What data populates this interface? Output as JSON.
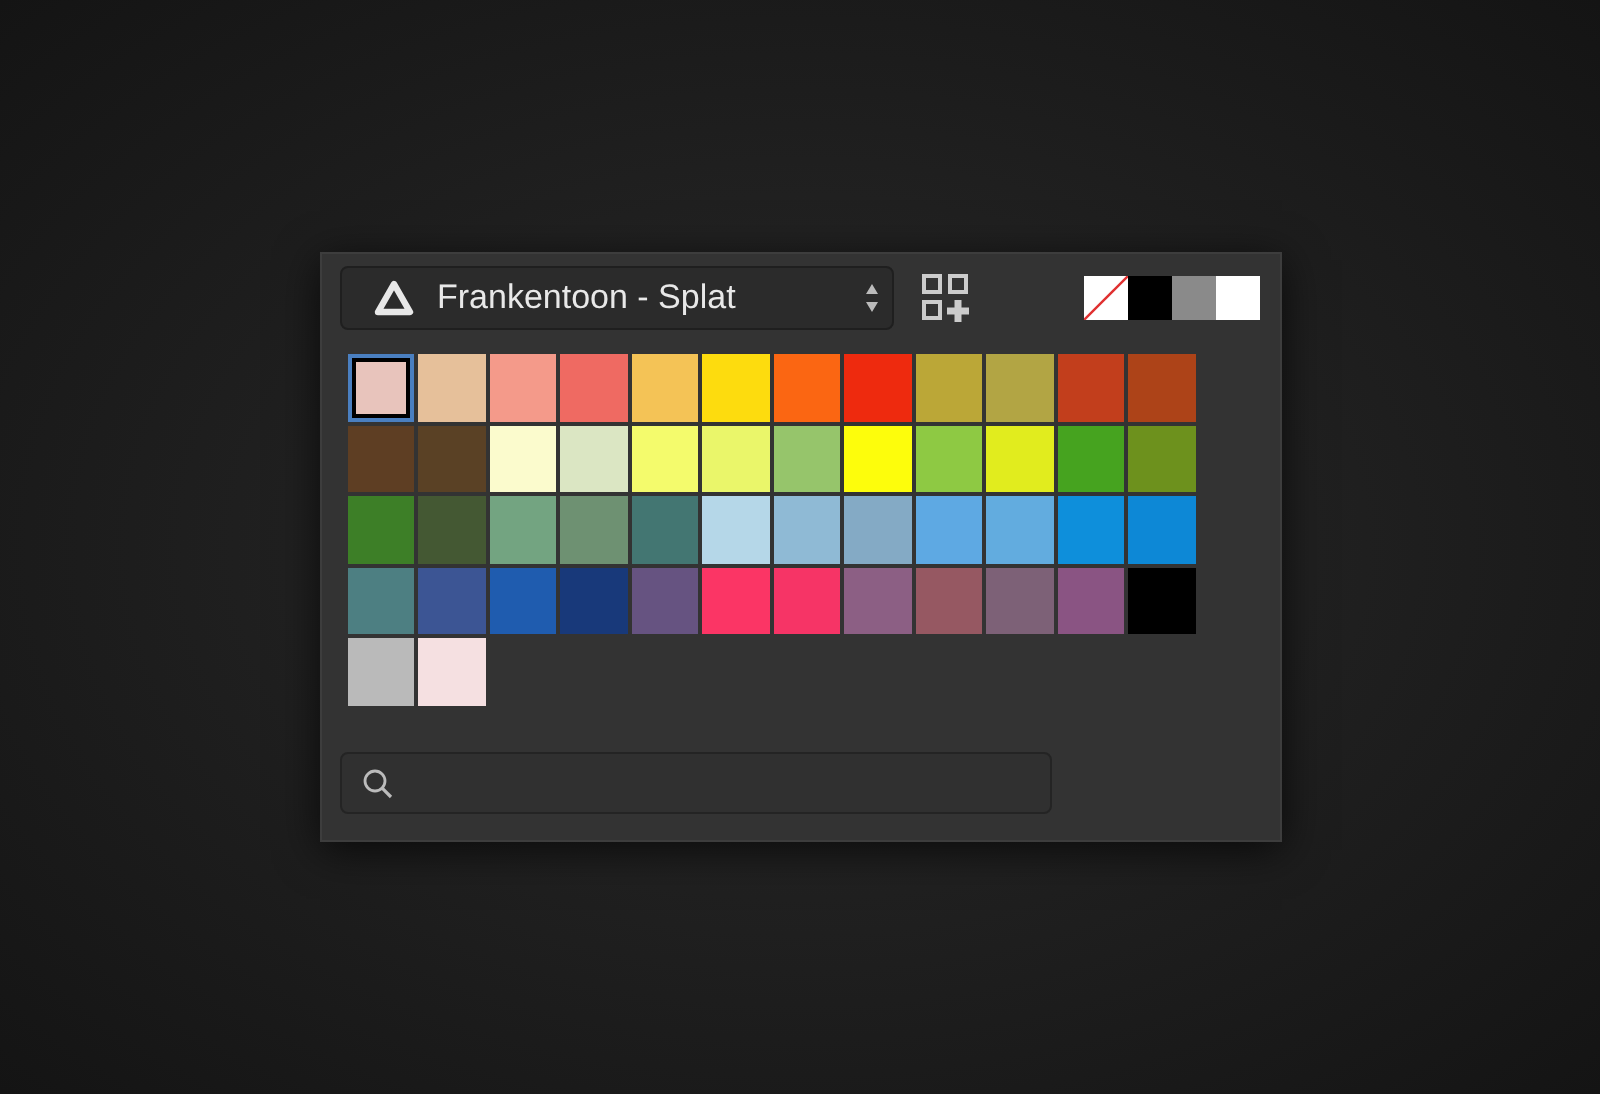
{
  "palette_selector": {
    "name": "Frankentoon - Splat"
  },
  "quick_swatches": [
    {
      "kind": "none",
      "color": "#ffffff"
    },
    {
      "kind": "solid",
      "color": "#000000"
    },
    {
      "kind": "solid",
      "color": "#8a8a8a"
    },
    {
      "kind": "solid",
      "color": "#ffffff"
    }
  ],
  "swatches": [
    {
      "color": "#e8c4bc",
      "selected": true
    },
    {
      "color": "#e6c09a",
      "selected": false
    },
    {
      "color": "#f49a8a",
      "selected": false
    },
    {
      "color": "#ef6a62",
      "selected": false
    },
    {
      "color": "#f4c356",
      "selected": false
    },
    {
      "color": "#fddc0e",
      "selected": false
    },
    {
      "color": "#fb6612",
      "selected": false
    },
    {
      "color": "#ee2a0e",
      "selected": false
    },
    {
      "color": "#bba737",
      "selected": false
    },
    {
      "color": "#b2a544",
      "selected": false
    },
    {
      "color": "#c23e1c",
      "selected": false
    },
    {
      "color": "#ad4318",
      "selected": false
    },
    {
      "color": "#5e3e23",
      "selected": false
    },
    {
      "color": "#5a4125",
      "selected": false
    },
    {
      "color": "#fbfbcd",
      "selected": false
    },
    {
      "color": "#dbe6c3",
      "selected": false
    },
    {
      "color": "#f4fb6c",
      "selected": false
    },
    {
      "color": "#eaf66a",
      "selected": false
    },
    {
      "color": "#96c56b",
      "selected": false
    },
    {
      "color": "#fdfd0c",
      "selected": false
    },
    {
      "color": "#8ec943",
      "selected": false
    },
    {
      "color": "#e1ec1e",
      "selected": false
    },
    {
      "color": "#46a31f",
      "selected": false
    },
    {
      "color": "#6d911d",
      "selected": false
    },
    {
      "color": "#3d7f27",
      "selected": false
    },
    {
      "color": "#445833",
      "selected": false
    },
    {
      "color": "#73a481",
      "selected": false
    },
    {
      "color": "#6e9172",
      "selected": false
    },
    {
      "color": "#437672",
      "selected": false
    },
    {
      "color": "#b5d7e8",
      "selected": false
    },
    {
      "color": "#8fbad5",
      "selected": false
    },
    {
      "color": "#84aac5",
      "selected": false
    },
    {
      "color": "#5ea9e3",
      "selected": false
    },
    {
      "color": "#62acdf",
      "selected": false
    },
    {
      "color": "#0e8fdb",
      "selected": false
    },
    {
      "color": "#0d88d6",
      "selected": false
    },
    {
      "color": "#4d7f82",
      "selected": false
    },
    {
      "color": "#3c5594",
      "selected": false
    },
    {
      "color": "#1f5caf",
      "selected": false
    },
    {
      "color": "#18397a",
      "selected": false
    },
    {
      "color": "#665381",
      "selected": false
    },
    {
      "color": "#fb3565",
      "selected": false
    },
    {
      "color": "#f63466",
      "selected": false
    },
    {
      "color": "#8c5f84",
      "selected": false
    },
    {
      "color": "#965862",
      "selected": false
    },
    {
      "color": "#7d6177",
      "selected": false
    },
    {
      "color": "#8a5483",
      "selected": false
    },
    {
      "color": "#000000",
      "selected": false
    },
    {
      "color": "#bababa",
      "selected": false
    },
    {
      "color": "#f5e0e1",
      "selected": false
    }
  ]
}
